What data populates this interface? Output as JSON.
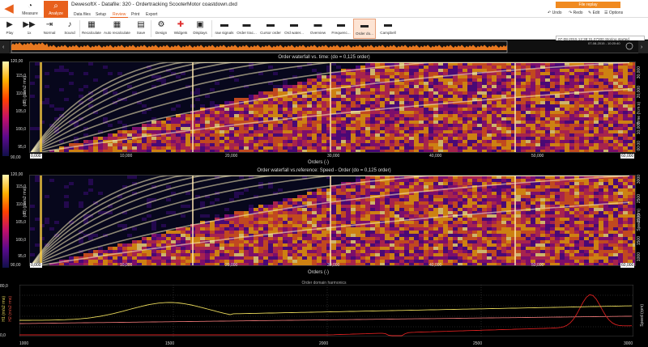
{
  "app": {
    "title": "DewesoftX - Datafile: 320 - Ordertracking ScooterMotor coastdown.dxd"
  },
  "main_tabs": [
    {
      "label": "Measure",
      "icon": "gauge-icon"
    },
    {
      "label": "Analyze",
      "icon": "analyze-icon"
    }
  ],
  "sub_tabs": [
    "Data files",
    "Setup",
    "Review",
    "Print",
    "Export"
  ],
  "replay": {
    "label": "File replay",
    "undo": "Undo",
    "redo": "Redo",
    "edit": "Edit",
    "options": "Options"
  },
  "log": [
    "07-08-2015 12:38:31,07300 Storing started",
    "07-08-2015 12:38:40,07565 Storing stopped"
  ],
  "toolbar": [
    {
      "label": "Play",
      "icon": "play-icon"
    },
    {
      "label": "1x",
      "icon": "forward-icon"
    },
    {
      "label": "Normal",
      "icon": "skip-icon"
    },
    {
      "label": "Sound",
      "icon": "speaker-icon"
    },
    {
      "label": "Recalculate",
      "icon": "calculator-icon"
    },
    {
      "label": "Auto recalculate",
      "icon": "auto-calc-icon"
    },
    {
      "label": "Save",
      "icon": "save-icon"
    },
    {
      "label": "Design",
      "icon": "gear-icon"
    },
    {
      "label": "Widgets",
      "icon": "plus-icon"
    },
    {
      "label": "Displays",
      "icon": "displays-icon"
    },
    {
      "label": "raw signals",
      "icon": "screen-icon"
    },
    {
      "label": "Order trac...",
      "icon": "screen-icon"
    },
    {
      "label": "Cursor order",
      "icon": "screen-icon"
    },
    {
      "label": "Ord water...",
      "icon": "screen-icon"
    },
    {
      "label": "Overview",
      "icon": "screen-icon"
    },
    {
      "label": "Frequenc...",
      "icon": "screen-icon"
    },
    {
      "label": "Order do...",
      "icon": "screen-icon"
    },
    {
      "label": "Campbell",
      "icon": "screen-icon"
    }
  ],
  "overview": {
    "time_label": "07-08-2015 - 10:20:40"
  },
  "panel1": {
    "title": "Order waterfall vs. time: (do = 0,125 order)",
    "cbar_top": "120,00",
    "cbar_bottom": "90,00",
    "yticks": [
      "115,0",
      "110,0",
      "105,0",
      "100,0",
      "95,0"
    ],
    "cbar_label": "(dB) (pm/s2 rms)",
    "xticks": [
      "0,000",
      "10,000",
      "20,000",
      "30,000",
      "40,000",
      "50,000",
      "60,000"
    ],
    "xtitle": "Orders (-)",
    "right_label": "Time (h:m:s)",
    "right_ticks": [
      "00:00",
      "10,000",
      "20,000",
      "30,000"
    ]
  },
  "panel2": {
    "title": "Order waterfall vs.reference: Speed - Order (do = 0,125 order)",
    "cbar_top": "120,00",
    "cbar_bottom": "90,00",
    "yticks": [
      "115,0",
      "110,0",
      "105,0",
      "100,0",
      "95,0"
    ],
    "cbar_label": "(dB) (pm/s2 rms)",
    "xticks": [
      "0,000",
      "10,000",
      "20,000",
      "30,000",
      "40,000",
      "50,000",
      "60,000"
    ],
    "xtitle": "Orders (-)",
    "right_label": "Speed (rpm)",
    "right_ticks": [
      "1000",
      "1500",
      "2000",
      "2500",
      "3000"
    ]
  },
  "harmonics": {
    "title": "Order domain harmonics",
    "left_label": "H1 (m/s2 rms)",
    "left_label2": "H2 (m/s2 rms)",
    "right_label": "Speed (rpm)",
    "y_left_top": "80,0",
    "y_left_bottom": "0,0",
    "y_right": [
      "1",
      "0,8",
      "0,6",
      "0,4",
      "0,2",
      "0"
    ],
    "xticks": [
      "1000",
      "1500",
      "2000",
      "2500",
      "3000"
    ],
    "colors": {
      "h1": "#e8d85a",
      "h2": "#d82020",
      "speed": "#e07070"
    }
  }
}
